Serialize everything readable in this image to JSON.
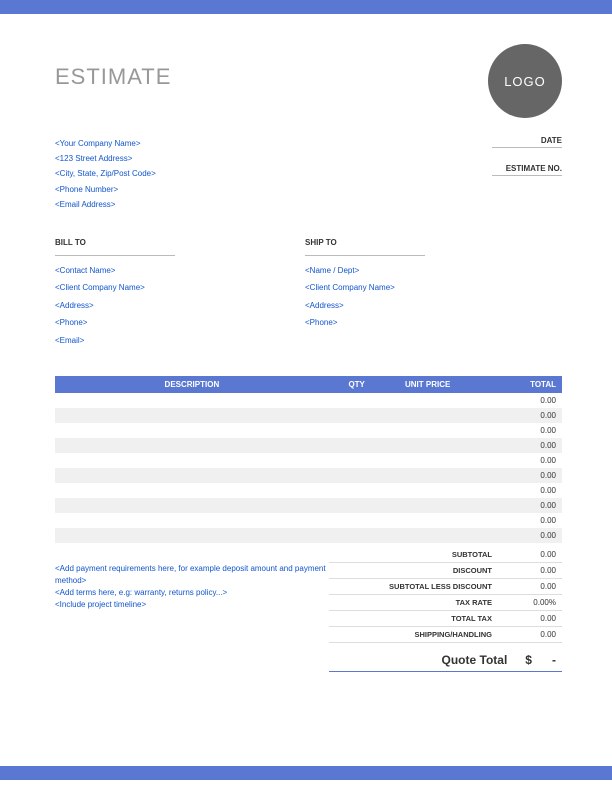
{
  "title": "ESTIMATE",
  "logo_text": "LOGO",
  "company": {
    "name": "<Your Company Name>",
    "address": "<123 Street Address>",
    "city": "<City, State, Zip/Post Code>",
    "phone": "<Phone Number>",
    "email": "<Email Address>"
  },
  "meta": {
    "date_label": "DATE",
    "estimate_no_label": "ESTIMATE NO."
  },
  "bill_to": {
    "heading": "BILL TO",
    "contact": "<Contact Name>",
    "company": "<Client Company Name>",
    "address": "<Address>",
    "phone": "<Phone>",
    "email": "<Email>"
  },
  "ship_to": {
    "heading": "SHIP TO",
    "name": "<Name / Dept>",
    "company": "<Client Company Name>",
    "address": "<Address>",
    "phone": "<Phone>"
  },
  "columns": {
    "description": "DESCRIPTION",
    "qty": "QTY",
    "unit_price": "UNIT PRICE",
    "total": "TOTAL"
  },
  "rows": [
    {
      "total": "0.00"
    },
    {
      "total": "0.00"
    },
    {
      "total": "0.00"
    },
    {
      "total": "0.00"
    },
    {
      "total": "0.00"
    },
    {
      "total": "0.00"
    },
    {
      "total": "0.00"
    },
    {
      "total": "0.00"
    },
    {
      "total": "0.00"
    },
    {
      "total": "0.00"
    }
  ],
  "notes": {
    "line1": "<Add payment requirements here, for example deposit amount and payment method>",
    "line2": "<Add terms here, e.g: warranty, returns policy...>",
    "line3": "<Include project timeline>"
  },
  "totals": {
    "subtotal_label": "SUBTOTAL",
    "subtotal": "0.00",
    "discount_label": "DISCOUNT",
    "discount": "0.00",
    "subtotal_less_discount_label": "SUBTOTAL LESS DISCOUNT",
    "subtotal_less_discount": "0.00",
    "tax_rate_label": "TAX RATE",
    "tax_rate": "0.00%",
    "total_tax_label": "TOTAL TAX",
    "total_tax": "0.00",
    "shipping_label": "SHIPPING/HANDLING",
    "shipping": "0.00"
  },
  "quote_total": {
    "label": "Quote Total",
    "currency": "$",
    "value": "-"
  }
}
